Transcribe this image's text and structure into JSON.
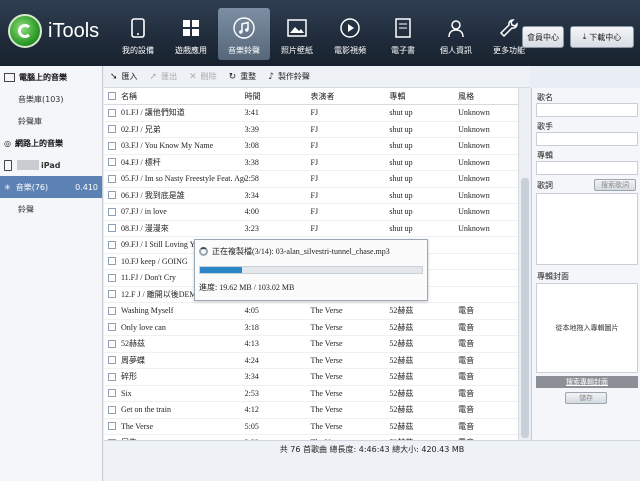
{
  "app": {
    "name": "iTools",
    "nav": [
      {
        "label": "我的設備",
        "icon": "phone-icon"
      },
      {
        "label": "遊戲應用",
        "icon": "apps-grid-icon"
      },
      {
        "label": "音樂鈴聲",
        "icon": "music-note-icon"
      },
      {
        "label": "照片壁紙",
        "icon": "picture-icon"
      },
      {
        "label": "電影視頻",
        "icon": "play-icon"
      },
      {
        "label": "電子書",
        "icon": "book-icon"
      },
      {
        "label": "個人資訊",
        "icon": "contacts-icon"
      },
      {
        "label": "更多功能",
        "icon": "wrench-icon"
      }
    ],
    "member_center": "會員中心",
    "download_center": "下載中心"
  },
  "sidebar": {
    "local_header": "電腦上的音樂",
    "local_items": [
      "音樂庫(103)",
      "鈴聲庫"
    ],
    "net_header": "網路上的音樂",
    "device_name": "iPad",
    "device_items": [
      {
        "label": "音樂(76)",
        "value": "0.410"
      },
      {
        "label": "鈴聲",
        "value": ""
      }
    ]
  },
  "toolbar": {
    "import": "匯入",
    "export": "匯出",
    "delete": "刪除",
    "refresh": "重整",
    "make_ringtone": "製作鈴聲"
  },
  "table": {
    "headers": [
      "名稱",
      "時間",
      "表演者",
      "專輯",
      "風格"
    ],
    "rows": [
      [
        "01.FJ / 讓他們知道",
        "3:41",
        "FJ",
        "shut up",
        "Unknown"
      ],
      [
        "02.FJ / 兄弟",
        "3:39",
        "FJ",
        "shut up",
        "Unknown"
      ],
      [
        "03.FJ / You Know My Name",
        "3:08",
        "FJ",
        "shut up",
        "Unknown"
      ],
      [
        "04.FJ / 標杆",
        "3:38",
        "FJ",
        "shut up",
        "Unknown"
      ],
      [
        "05.FJ / Im so Nasty Freestyle Feat. Agogo",
        "2:58",
        "FJ",
        "shut up",
        "Unknown"
      ],
      [
        "06.FJ / 我到底是誰",
        "3:34",
        "FJ",
        "shut up",
        "Unknown"
      ],
      [
        "07.FJ / in love",
        "4:00",
        "FJ",
        "shut up",
        "Unknown"
      ],
      [
        "08.FJ / 漫漫來",
        "3:23",
        "FJ",
        "shut up",
        "Unknown"
      ],
      [
        "09.FJ / I Still Loving You",
        "",
        "",
        "",
        ""
      ],
      [
        "10.FJ keep / GOING",
        "",
        "",
        "",
        ""
      ],
      [
        "11.FJ / Don't Cry",
        "",
        "",
        "",
        ""
      ],
      [
        "12.F J / 離開以後DEMO",
        "",
        "",
        "",
        ""
      ],
      [
        "Washing Myself",
        "4:05",
        "The Verse",
        "52赫茲",
        "電音"
      ],
      [
        "Only love can",
        "3:18",
        "The Verse",
        "52赫茲",
        "電音"
      ],
      [
        "52赫茲",
        "4:13",
        "The Verse",
        "52赫茲",
        "電音"
      ],
      [
        "周夢蝶",
        "4:24",
        "The Verse",
        "52赫茲",
        "電音"
      ],
      [
        "碎形",
        "3:34",
        "The Verse",
        "52赫茲",
        "電音"
      ],
      [
        "Six",
        "2:53",
        "The Verse",
        "52赫茲",
        "電音"
      ],
      [
        "Get on the train",
        "4:12",
        "The Verse",
        "52赫茲",
        "電音"
      ],
      [
        "The Verse",
        "5:05",
        "The Verse",
        "52赫茲",
        "電音"
      ],
      [
        "犀牛",
        "3:32",
        "The Verse",
        "52赫茲",
        "電音"
      ],
      [
        "快速逃離",
        "3:50",
        "The Verse",
        "52赫茲",
        "電音"
      ]
    ]
  },
  "dialog": {
    "copying": "正在複製檔(3/14): 03-alan_silvestri-tunnel_chase.mp3",
    "progress": "進度: 19.62 MB / 103.02 MB",
    "progress_fraction": 0.19
  },
  "status": "共 76 首歌曲   總長度: 4:46:43   總大小: 420.43 MB",
  "details": {
    "song_name": "歌名",
    "artist": "歌手",
    "album": "專輯",
    "lyrics": "歌詞",
    "search_lyrics": "搜索歌詞",
    "album_cover": "專輯封面",
    "drag_hint": "從本地拖入專輯圖片",
    "search_cover": "搜索專輯封面",
    "save": "儲存"
  }
}
